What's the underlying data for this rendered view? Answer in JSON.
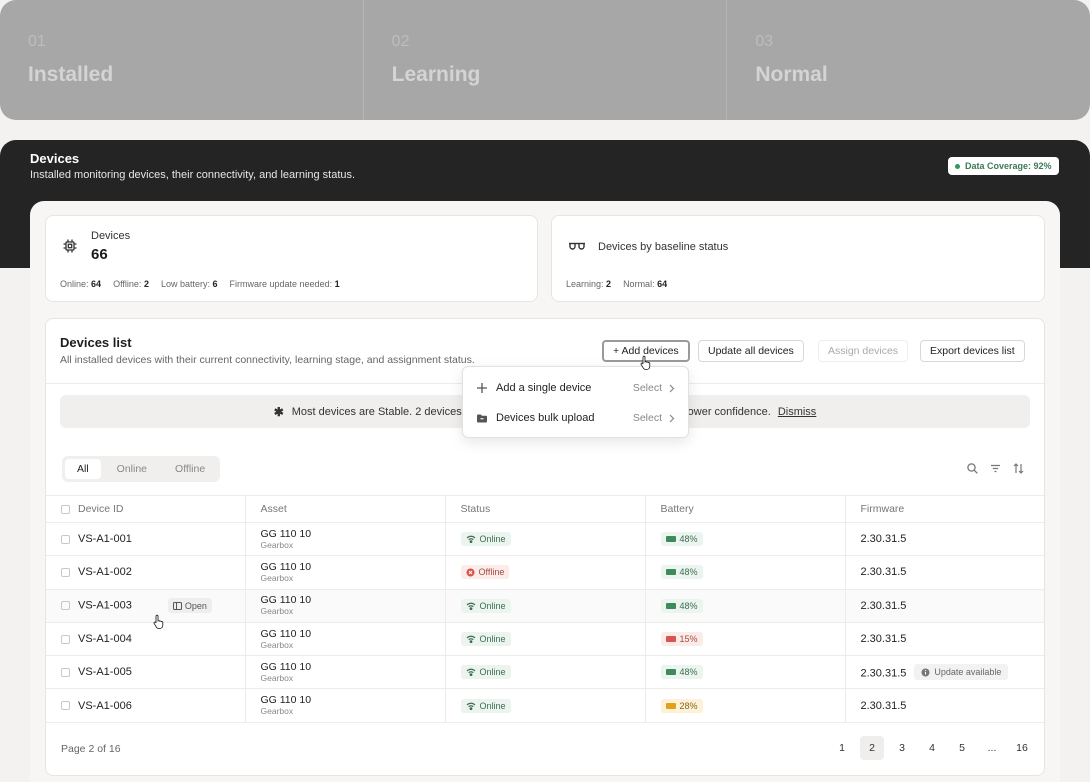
{
  "stepper": {
    "steps": [
      {
        "num": "01",
        "title": "Installed"
      },
      {
        "num": "02",
        "title": "Learning"
      },
      {
        "num": "03",
        "title": "Normal"
      }
    ]
  },
  "header": {
    "title": "Devices",
    "subtitle": "Installed monitoring devices, their connectivity, and learning status.",
    "coverage": "Data Coverage: 92%"
  },
  "summary": {
    "devices_label": "Devices",
    "devices_count": "66",
    "stats": [
      {
        "label": "Online:",
        "value": "64"
      },
      {
        "label": "Offline:",
        "value": "2"
      },
      {
        "label": "Low battery:",
        "value": "6"
      },
      {
        "label": "Firmware update needed:",
        "value": "1"
      }
    ],
    "baseline_label": "Devices by baseline status",
    "baseline_stats": [
      {
        "label": "Learning:",
        "value": "2"
      },
      {
        "label": "Normal:",
        "value": "64"
      }
    ]
  },
  "list": {
    "title": "Devices list",
    "subtitle": "All installed devices with their current connectivity, learning stage, and assignment status.",
    "buttons": {
      "add": "+ Add devices",
      "update": "Update all devices",
      "assign": "Assign devices",
      "export": "Export devices list"
    },
    "notice": {
      "text_start": "Most devices are Stable. 2 devices are st",
      "text_end": "have lower confidence.",
      "dismiss": "Dismiss"
    },
    "filters": [
      "All",
      "Online",
      "Offline"
    ],
    "columns": [
      "Device ID",
      "Asset",
      "Status",
      "Battery",
      "Firmware"
    ],
    "rows": [
      {
        "id": "VS-A1-001",
        "asset": "GG 110 10",
        "asset_type": "Gearbox",
        "status": "Online",
        "battery": "48%",
        "firmware": "2.30.31.5"
      },
      {
        "id": "VS-A1-002",
        "asset": "GG 110 10",
        "asset_type": "Gearbox",
        "status": "Offline",
        "battery": "48%",
        "firmware": "2.30.31.5"
      },
      {
        "id": "VS-A1-003",
        "asset": "GG 110 10",
        "asset_type": "Gearbox",
        "status": "Online",
        "battery": "48%",
        "firmware": "2.30.31.5"
      },
      {
        "id": "VS-A1-004",
        "asset": "GG 110 10",
        "asset_type": "Gearbox",
        "status": "Online",
        "battery": "15%",
        "firmware": "2.30.31.5"
      },
      {
        "id": "VS-A1-005",
        "asset": "GG 110 10",
        "asset_type": "Gearbox",
        "status": "Online",
        "battery": "48%",
        "firmware": "2.30.31.5"
      },
      {
        "id": "VS-A1-006",
        "asset": "GG 110 10",
        "asset_type": "Gearbox",
        "status": "Online",
        "battery": "28%",
        "firmware": "2.30.31.5"
      }
    ],
    "open_label": "Open",
    "update_available": "Update available",
    "pagination": {
      "info": "Page 2 of 16",
      "pages": [
        "1",
        "2",
        "3",
        "4",
        "5",
        "...",
        "16"
      ]
    }
  },
  "dropdown": {
    "items": [
      {
        "label": "Add a single device",
        "action": "Select"
      },
      {
        "label": "Devices bulk upload",
        "action": "Select"
      }
    ]
  },
  "colors": {
    "online": "#3d6e4f",
    "offline": "#a44a3e",
    "battery_ok": "#3d8a5a",
    "battery_low": "#d9534f",
    "battery_mid": "#e0a21a"
  }
}
